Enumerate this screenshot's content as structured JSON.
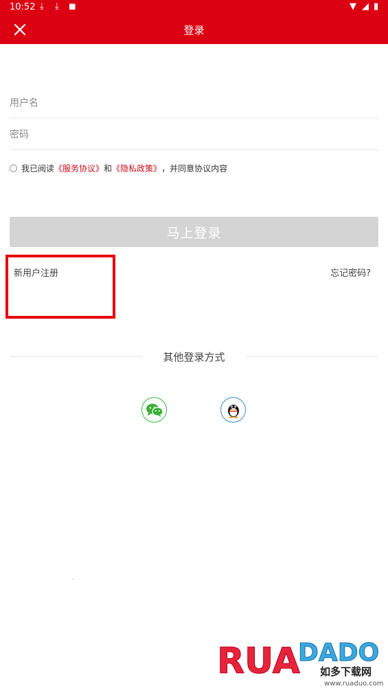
{
  "status_bar": {
    "time": "10:52"
  },
  "nav": {
    "title": "登录"
  },
  "form": {
    "username_placeholder": "用户名",
    "password_placeholder": "密码"
  },
  "agreement": {
    "prefix": "我已阅读",
    "service_link": "《服务协议》",
    "and": "和",
    "privacy_link": "《隐私政策》",
    "suffix": "，并同意协议内容"
  },
  "login_button": "马上登录",
  "register_link": "新用户注册",
  "forgot_link": "忘记密码?",
  "other_login": {
    "title": "其他登录方式",
    "options": [
      {
        "icon": "wechat-icon"
      },
      {
        "icon": "qq-icon"
      }
    ]
  },
  "watermark": {
    "logo_text": "RUADADO",
    "cn_text": "如多下载网",
    "url": "www.ruaduo.com"
  },
  "colors": {
    "header_red": "#dc0112",
    "link_red": "#c8101e",
    "button_gray": "#d4d4d4",
    "highlight_red": "#e8000b"
  }
}
